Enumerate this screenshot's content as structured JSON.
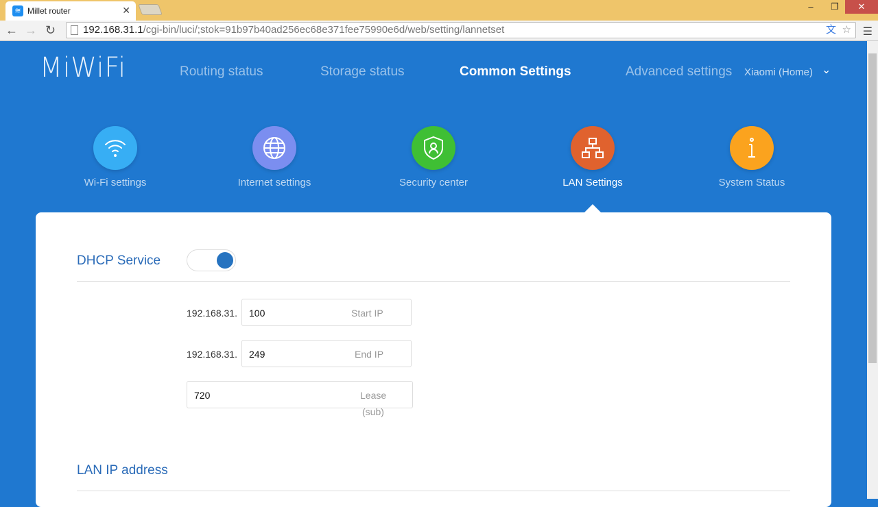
{
  "browser": {
    "tab_title": "Millet router",
    "url_host": "192.168.31.1",
    "url_path": "/cgi-bin/luci/;stok=91b97b40ad256ec68e371fee75990e6d/web/setting/lannetset"
  },
  "header": {
    "logo": "MiWiFi",
    "nav": [
      "Routing status",
      "Storage status",
      "Common Settings",
      "Advanced settings"
    ],
    "user": "Xiaomi (Home)"
  },
  "tiles": [
    {
      "label": "Wi-Fi settings",
      "color": "#37aef4"
    },
    {
      "label": "Internet settings",
      "color": "#7b8ef0"
    },
    {
      "label": "Security center",
      "color": "#3fbf34"
    },
    {
      "label": "LAN Settings",
      "color": "#e0622e"
    },
    {
      "label": "System Status",
      "color": "#fba31e"
    }
  ],
  "dhcp": {
    "title": "DHCP Service",
    "enabled": true,
    "prefix": "192.168.31.",
    "start_ip": "100",
    "start_label": "Start IP",
    "end_ip": "249",
    "end_label": "End IP",
    "lease": "720",
    "lease_label": "Lease",
    "lease_unit": "(sub)"
  },
  "lan": {
    "title": "LAN IP address"
  }
}
